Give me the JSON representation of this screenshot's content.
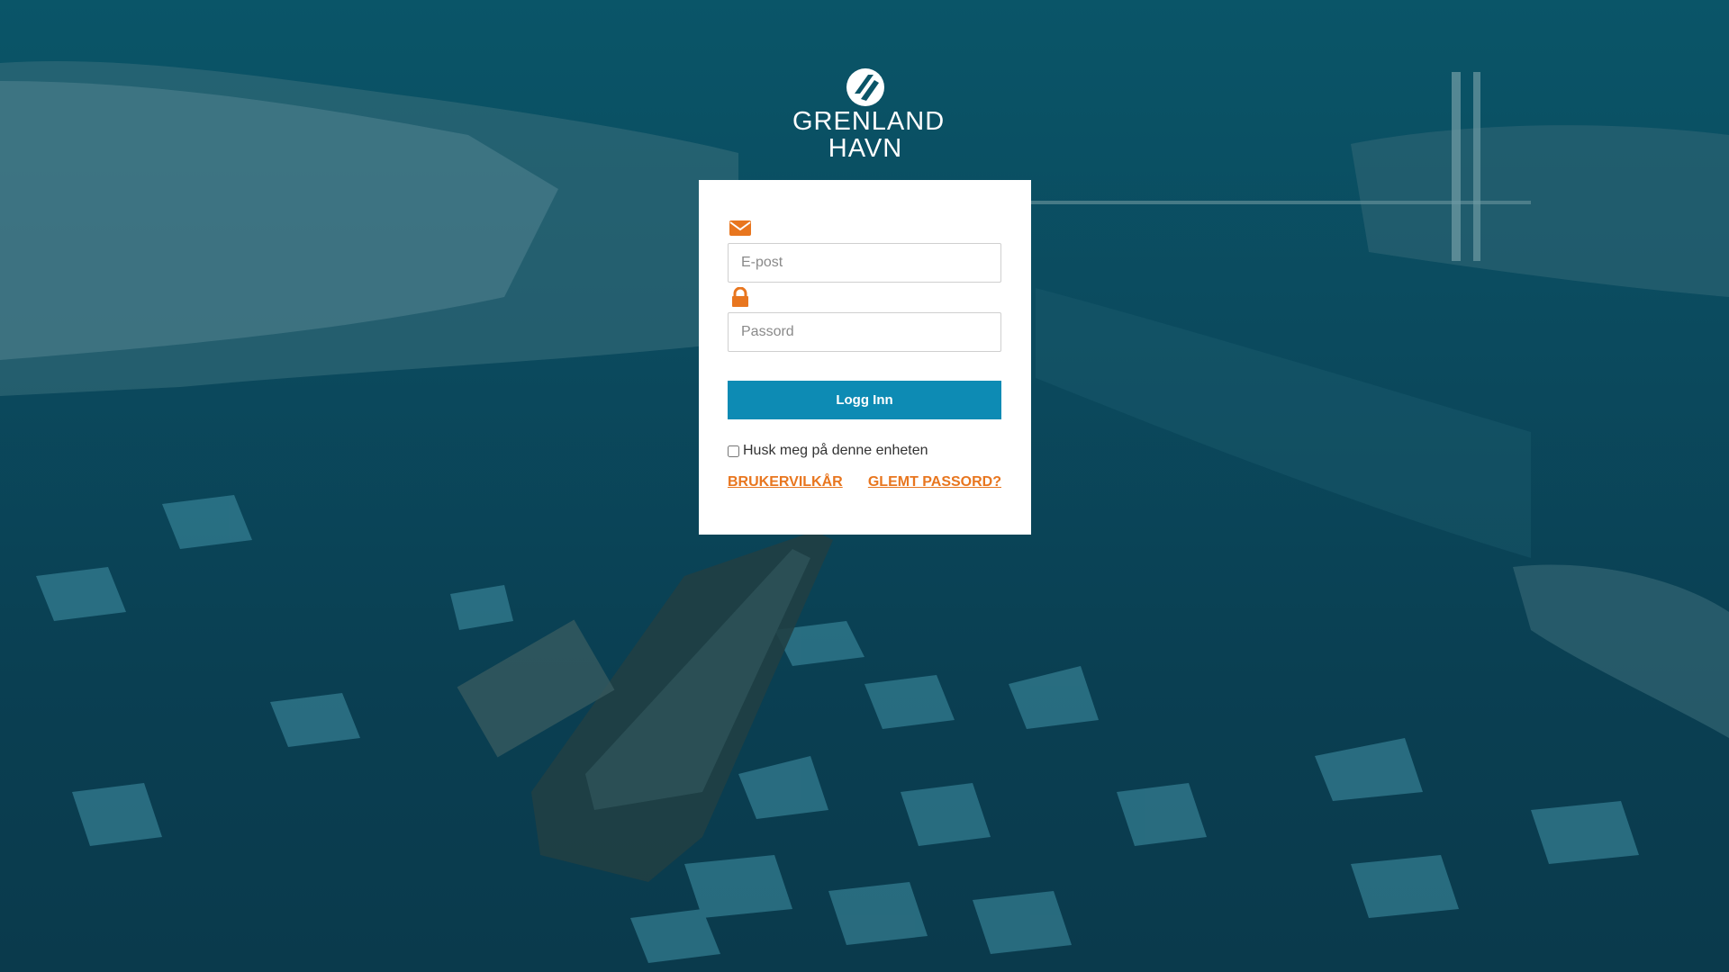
{
  "brand": {
    "line1": "GRENLAND",
    "line2": "HAVN",
    "logo_icon": "grenland-havn-mark-icon"
  },
  "login_form": {
    "email_icon": "envelope-icon",
    "email_placeholder": "E-post",
    "email_value": "",
    "password_icon": "lock-icon",
    "password_placeholder": "Passord",
    "password_value": "",
    "submit_label": "Logg Inn",
    "remember_label": "Husk meg på denne enheten",
    "remember_checked": false,
    "terms_link": "BRUKERVILKÅR",
    "forgot_link": "GLEMT PASSORD?"
  },
  "colors": {
    "background_tint": "#0a4a5e",
    "primary_button": "#0d8bb4",
    "accent_icons_links": "#e8761f",
    "card_background": "#ffffff"
  }
}
